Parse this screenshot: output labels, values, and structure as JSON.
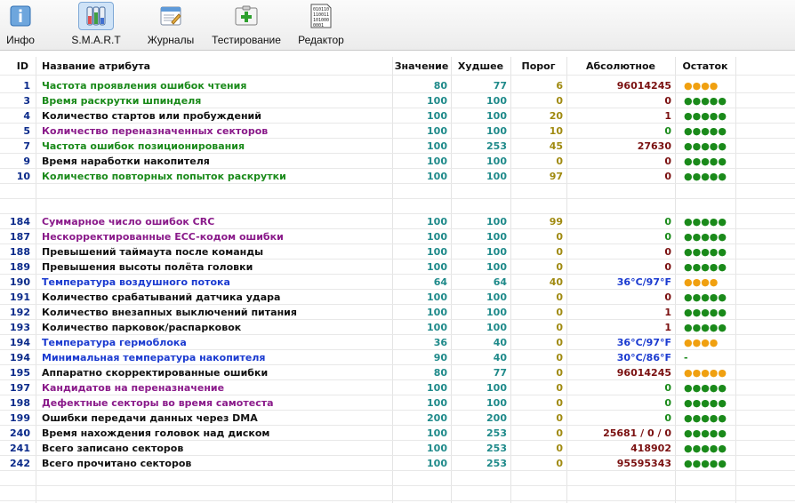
{
  "toolbar": {
    "buttons": [
      {
        "label": "Инфо",
        "icon": "info-icon"
      },
      {
        "label": "S.M.A.R.T",
        "icon": "smart-icon"
      },
      {
        "label": "Журналы",
        "icon": "journal-icon"
      },
      {
        "label": "Тестирование",
        "icon": "test-icon"
      },
      {
        "label": "Редактор",
        "icon": "binary-editor-icon"
      }
    ]
  },
  "table": {
    "headers": {
      "id": "ID",
      "name": "Название атрибута",
      "value": "Значение",
      "worst": "Худшее",
      "threshold": "Порог",
      "raw": "Абсолютное",
      "remaining": "Остаток"
    },
    "rows": [
      {
        "id": "1",
        "name": "Частота проявления ошибок чтения",
        "value": "80",
        "worst": "77",
        "threshold": "6",
        "raw": "96014245",
        "remaining": "●●●●",
        "nameColor": "#1a8a1a",
        "rawColor": "#7a1010",
        "remColor": "#f0a010"
      },
      {
        "id": "3",
        "name": "Время раскрутки шпинделя",
        "value": "100",
        "worst": "100",
        "threshold": "0",
        "raw": "0",
        "remaining": "●●●●●",
        "nameColor": "#1a8a1a",
        "rawColor": "#7a1010",
        "remColor": "#1a8a1a"
      },
      {
        "id": "4",
        "name": "Количество стартов или пробуждений",
        "value": "100",
        "worst": "100",
        "threshold": "20",
        "raw": "1",
        "remaining": "●●●●●",
        "nameColor": "#111111",
        "rawColor": "#7a1010",
        "remColor": "#1a8a1a"
      },
      {
        "id": "5",
        "name": "Количество переназначенных секторов",
        "value": "100",
        "worst": "100",
        "threshold": "10",
        "raw": "0",
        "remaining": "●●●●●",
        "nameColor": "#8a1a8a",
        "rawColor": "#1a8a1a",
        "remColor": "#1a8a1a"
      },
      {
        "id": "7",
        "name": "Частота ошибок позиционирования",
        "value": "100",
        "worst": "253",
        "threshold": "45",
        "raw": "27630",
        "remaining": "●●●●●",
        "nameColor": "#1a8a1a",
        "rawColor": "#7a1010",
        "remColor": "#1a8a1a"
      },
      {
        "id": "9",
        "name": "Время наработки накопителя",
        "value": "100",
        "worst": "100",
        "threshold": "0",
        "raw": "0",
        "remaining": "●●●●●",
        "nameColor": "#111111",
        "rawColor": "#7a1010",
        "remColor": "#1a8a1a"
      },
      {
        "id": "10",
        "name": "Количество повторных попыток раскрутки",
        "value": "100",
        "worst": "100",
        "threshold": "97",
        "raw": "0",
        "remaining": "●●●●●",
        "nameColor": "#1a8a1a",
        "rawColor": "#7a1010",
        "remColor": "#1a8a1a"
      },
      {
        "id": "184",
        "name": "Суммарное число ошибок CRC",
        "value": "100",
        "worst": "100",
        "threshold": "99",
        "raw": "0",
        "remaining": "●●●●●",
        "nameColor": "#8a1a8a",
        "rawColor": "#1a8a1a",
        "remColor": "#1a8a1a"
      },
      {
        "id": "187",
        "name": "Нескорректированные ECC-кодом ошибки",
        "value": "100",
        "worst": "100",
        "threshold": "0",
        "raw": "0",
        "remaining": "●●●●●",
        "nameColor": "#8a1a8a",
        "rawColor": "#1a8a1a",
        "remColor": "#1a8a1a"
      },
      {
        "id": "188",
        "name": "Превышений таймаута после команды",
        "value": "100",
        "worst": "100",
        "threshold": "0",
        "raw": "0",
        "remaining": "●●●●●",
        "nameColor": "#111111",
        "rawColor": "#7a1010",
        "remColor": "#1a8a1a"
      },
      {
        "id": "189",
        "name": "Превышения высоты полёта головки",
        "value": "100",
        "worst": "100",
        "threshold": "0",
        "raw": "0",
        "remaining": "●●●●●",
        "nameColor": "#111111",
        "rawColor": "#7a1010",
        "remColor": "#1a8a1a"
      },
      {
        "id": "190",
        "name": "Температура воздушного потока",
        "value": "64",
        "worst": "64",
        "threshold": "40",
        "raw": "36°C/97°F",
        "remaining": "●●●●",
        "nameColor": "#1a3ad0",
        "rawColor": "#1a3ad0",
        "remColor": "#f0a010"
      },
      {
        "id": "191",
        "name": "Количество срабатываний датчика удара",
        "value": "100",
        "worst": "100",
        "threshold": "0",
        "raw": "0",
        "remaining": "●●●●●",
        "nameColor": "#111111",
        "rawColor": "#7a1010",
        "remColor": "#1a8a1a"
      },
      {
        "id": "192",
        "name": "Количество внезапных выключений питания",
        "value": "100",
        "worst": "100",
        "threshold": "0",
        "raw": "1",
        "remaining": "●●●●●",
        "nameColor": "#111111",
        "rawColor": "#7a1010",
        "remColor": "#1a8a1a"
      },
      {
        "id": "193",
        "name": "Количество парковок/распарковок",
        "value": "100",
        "worst": "100",
        "threshold": "0",
        "raw": "1",
        "remaining": "●●●●●",
        "nameColor": "#111111",
        "rawColor": "#7a1010",
        "remColor": "#1a8a1a"
      },
      {
        "id": "194",
        "name": "Температура гермоблока",
        "value": "36",
        "worst": "40",
        "threshold": "0",
        "raw": "36°C/97°F",
        "remaining": "●●●●",
        "nameColor": "#1a3ad0",
        "rawColor": "#1a3ad0",
        "remColor": "#f0a010"
      },
      {
        "id": "194",
        "name": "Минимальная температура накопителя",
        "value": "90",
        "worst": "40",
        "threshold": "0",
        "raw": "30°C/86°F",
        "remaining": "-",
        "nameColor": "#1a3ad0",
        "rawColor": "#1a3ad0",
        "remColor": "#1a8a1a"
      },
      {
        "id": "195",
        "name": "Аппаратно скорректированные ошибки",
        "value": "80",
        "worst": "77",
        "threshold": "0",
        "raw": "96014245",
        "remaining": "●●●●●",
        "nameColor": "#111111",
        "rawColor": "#7a1010",
        "remColor": "#f0a010"
      },
      {
        "id": "197",
        "name": "Кандидатов на переназначение",
        "value": "100",
        "worst": "100",
        "threshold": "0",
        "raw": "0",
        "remaining": "●●●●●",
        "nameColor": "#8a1a8a",
        "rawColor": "#1a8a1a",
        "remColor": "#1a8a1a"
      },
      {
        "id": "198",
        "name": "Дефектные секторы во время самотеста",
        "value": "100",
        "worst": "100",
        "threshold": "0",
        "raw": "0",
        "remaining": "●●●●●",
        "nameColor": "#8a1a8a",
        "rawColor": "#1a8a1a",
        "remColor": "#1a8a1a"
      },
      {
        "id": "199",
        "name": "Ошибки передачи данных через DMA",
        "value": "200",
        "worst": "200",
        "threshold": "0",
        "raw": "0",
        "remaining": "●●●●●",
        "nameColor": "#111111",
        "rawColor": "#1a8a1a",
        "remColor": "#1a8a1a"
      },
      {
        "id": "240",
        "name": "Время нахождения головок над диском",
        "value": "100",
        "worst": "253",
        "threshold": "0",
        "raw": "25681 / 0 / 0",
        "remaining": "●●●●●",
        "nameColor": "#111111",
        "rawColor": "#7a1010",
        "remColor": "#1a8a1a"
      },
      {
        "id": "241",
        "name": "Всего записано секторов",
        "value": "100",
        "worst": "253",
        "threshold": "0",
        "raw": "418902",
        "remaining": "●●●●●",
        "nameColor": "#111111",
        "rawColor": "#7a1010",
        "remColor": "#1a8a1a"
      },
      {
        "id": "242",
        "name": "Всего прочитано секторов",
        "value": "100",
        "worst": "253",
        "threshold": "0",
        "raw": "95595343",
        "remaining": "●●●●●",
        "nameColor": "#111111",
        "rawColor": "#7a1010",
        "remColor": "#1a8a1a"
      }
    ]
  }
}
